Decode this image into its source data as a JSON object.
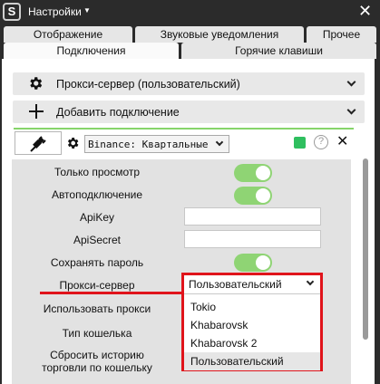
{
  "window": {
    "title": "Настройки",
    "close_glyph": "✕"
  },
  "tabs": [
    {
      "label": "Отображение",
      "active": false
    },
    {
      "label": "Звуковые уведомления",
      "active": false
    },
    {
      "label": "Прочее",
      "active": false
    },
    {
      "label": "Подключения",
      "active": true
    },
    {
      "label": "Горячие клавиши",
      "active": false
    }
  ],
  "proxy_section": {
    "label": "Прокси-сервер (пользовательский)",
    "icon": "gear-icon"
  },
  "add_connection": {
    "label": "Добавить подключение",
    "icon": "plus-icon"
  },
  "connection": {
    "exchange_select": "Binance: Квартальные ф",
    "status_color": "#2fbf5f",
    "help_glyph": "?",
    "remove_glyph": "✕"
  },
  "settings": {
    "view_only": "Только просмотр",
    "auto_connect": "Автоподключение",
    "api_key": "ApiKey",
    "api_secret": "ApiSecret",
    "save_password": "Сохранять пароль",
    "proxy_server": "Прокси-сервер",
    "use_proxy": "Использовать прокси",
    "wallet_type": "Тип кошелька",
    "reset_history_line1": "Сбросить историю",
    "reset_history_line2": "торговли по кошельку"
  },
  "proxy_dropdown": {
    "selected": "Пользовательский",
    "options": [
      "Tokio",
      "Khabarovsk",
      "Khabarovsk 2",
      "Пользовательский"
    ],
    "highlight_color": "#e0141b"
  },
  "colors": {
    "toggle_on": "#8fd474",
    "accent_line": "#86d46a",
    "annotation_red": "#e0141b"
  }
}
